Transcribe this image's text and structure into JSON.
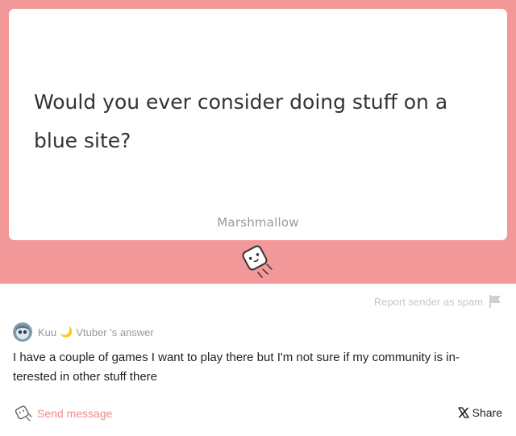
{
  "question": {
    "text": "Would you ever consider doing stuff on a blue site?",
    "brand": "Marshmallow"
  },
  "mascot": {
    "icon": "marshmallow-mascot-icon"
  },
  "report": {
    "label": "Report sender as spam",
    "icon": "flag-icon"
  },
  "answerer": {
    "name": "Kuu",
    "emoji": "🌙",
    "suffix": "Vtuber 's answer"
  },
  "answer": {
    "text": "I have a couple of games I want to play there but I'm not sure if my community is in-terested in other stuff there"
  },
  "actions": {
    "send_message": "Send message",
    "share": "Share"
  },
  "colors": {
    "band": "#f39899",
    "accent": "#f08a8c",
    "muted": "#999999"
  }
}
